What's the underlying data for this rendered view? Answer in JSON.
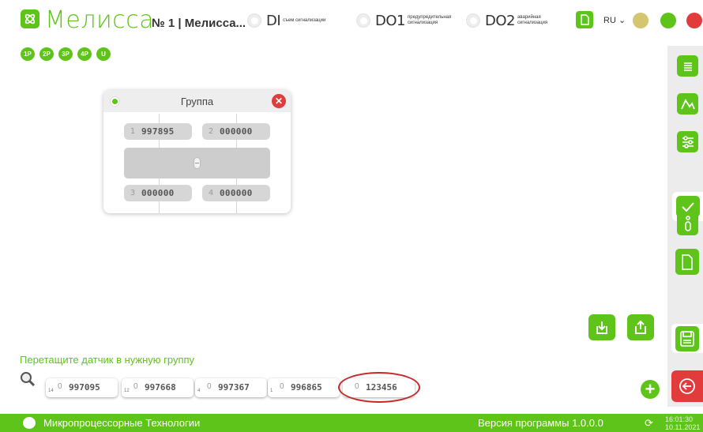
{
  "colors": {
    "accent": "#5ec419",
    "danger": "#e23b3b",
    "warning": "#d4c56f",
    "ok": "#5ec419"
  },
  "header": {
    "brand": "Мелисса",
    "device_title": "№ 1 | Мелисса...",
    "signals": [
      {
        "code": "DI",
        "desc": "съем сигнализации"
      },
      {
        "code": "DO1",
        "desc": "предупредительная сигнализация"
      },
      {
        "code": "DO2",
        "desc": "аварийная сигнализация"
      }
    ],
    "language": "RU ⌄",
    "icons": [
      "document-icon",
      "status-yellow-dot",
      "status-green-dot",
      "status-red-dot"
    ]
  },
  "group_tabs": [
    "1P",
    "2P",
    "3P",
    "4P",
    "U"
  ],
  "group_card": {
    "title": "Группа",
    "slots": [
      {
        "n": "1",
        "value": "997895"
      },
      {
        "n": "2",
        "value": "000000"
      },
      {
        "n": "3",
        "value": "000000"
      },
      {
        "n": "4",
        "value": "000000"
      }
    ]
  },
  "drag_hint": "Перетащите датчик в нужную группу",
  "sensors": [
    {
      "sub": "14",
      "n": "0",
      "value": "997095"
    },
    {
      "sub": "12",
      "n": "0",
      "value": "997668"
    },
    {
      "sub": "4",
      "n": "0",
      "value": "997367"
    },
    {
      "sub": "1",
      "n": "0",
      "value": "996865"
    },
    {
      "sub": "",
      "n": "0",
      "value": "123456"
    }
  ],
  "sidebar": [
    "list-icon",
    "chart-icon",
    "sliders-icon",
    "check-icon",
    "info-icon",
    "document-icon",
    "save-icon",
    "exit-icon"
  ],
  "footer": {
    "company": "Микропроцессорные Технологии",
    "version": "Версия программы  1.0.0.0",
    "time": "16:01:30",
    "date": "10.11.2021"
  }
}
